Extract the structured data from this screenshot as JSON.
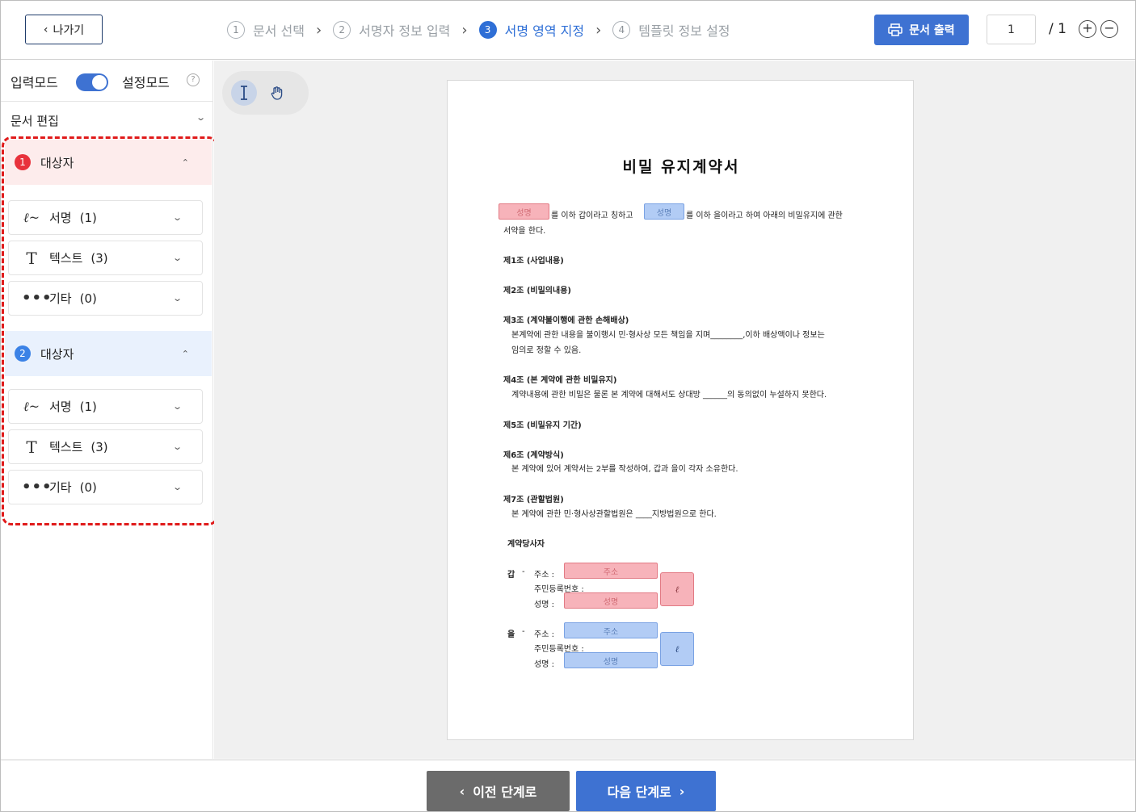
{
  "header": {
    "back_label": "나가기",
    "steps": [
      {
        "num": "1",
        "label": "문서 선택"
      },
      {
        "num": "2",
        "label": "서명자 정보 입력"
      },
      {
        "num": "3",
        "label": "서명 영역 지정"
      },
      {
        "num": "4",
        "label": "템플릿 정보 설정"
      }
    ],
    "active_step": 3,
    "print_label": "문서 출력",
    "page_current": "1",
    "page_total": "/ 1",
    "zoom_in": "+",
    "zoom_out": "−"
  },
  "sidebar": {
    "input_mode": "입력모드",
    "setting_mode": "설정모드",
    "toggle_on": true,
    "doc_edit": "문서 편집",
    "parties": [
      {
        "num": "1",
        "title": "대상자",
        "color": "#e8323c",
        "fields": [
          {
            "icon": "signature-icon",
            "label": "서명",
            "count": "(1)"
          },
          {
            "icon": "text-icon",
            "label": "텍스트",
            "count": "(3)"
          },
          {
            "icon": "more-icon",
            "label": "기타",
            "count": "(0)"
          }
        ]
      },
      {
        "num": "2",
        "title": "대상자",
        "color": "#3b82e6",
        "fields": [
          {
            "icon": "signature-icon",
            "label": "서명",
            "count": "(1)"
          },
          {
            "icon": "text-icon",
            "label": "텍스트",
            "count": "(3)"
          },
          {
            "icon": "more-icon",
            "label": "기타",
            "count": "(0)"
          }
        ]
      }
    ]
  },
  "document": {
    "title": "비밀 유지계약서",
    "intro_1a": "를 이하 갑이라고 칭하고",
    "intro_1b": "를 이하 을이라고 하여 아래의 비밀유지에 관한",
    "intro_2": "서약을 한다.",
    "field_name": "성명",
    "field_address": "주소",
    "article_1": "제1조 (사업내용)",
    "article_2": "제2조 (비밀의내용)",
    "article_3": "제3조 (계약불이행에 관한 손해배상)",
    "article_3_body_1": "본계약에 관한 내용을 불이행시 민·형사상 모든 책임을 지며________,이하 배상액이나 정보는",
    "article_3_body_2": "임의로 정할 수 있음.",
    "article_4": "제4조 (본 계약에 관한 비밀유지)",
    "article_4_body": "계약내용에 관한 비밀은 물론 본 계약에 대해서도 상대방 ______의 동의없이 누설하지 못한다.",
    "article_5": "제5조 (비밀유지 기간)",
    "article_6": "제6조 (계약방식)",
    "article_6_body": "본 계약에 있어 계약서는 2부를 작성하여, 갑과 을이 각자 소유한다.",
    "article_7": "제7조 (관할법원)",
    "article_7_body": "본 계약에 관한 민·형사상관할법원은 ____지방법원으로 한다.",
    "parties_heading": "계약당사자",
    "party_a": "갑",
    "party_b": "을",
    "dash": "-",
    "address_label": "주소 :",
    "rrn_label": "주민등록번호 :",
    "name_label": "성명 :",
    "seal_glyph": "ℓ"
  },
  "footer": {
    "prev_label": "이전 단계로",
    "next_label": "다음 단계로"
  },
  "colors": {
    "primary": "#3e72d2",
    "party1": "#e8323c",
    "party2": "#3b82e6",
    "highlight_dashed": "#e01b1b"
  }
}
